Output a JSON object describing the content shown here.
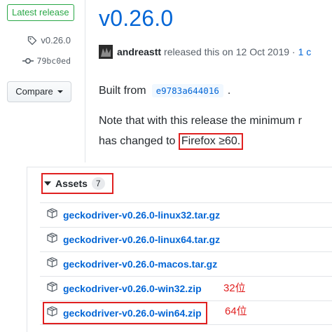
{
  "sidebar": {
    "badge": "Latest release",
    "tag": "v0.26.0",
    "commit": "79bc0ed",
    "compare_label": "Compare"
  },
  "release": {
    "title": "v0.26.0",
    "author": "andreastt",
    "released_text": "released this on 12 Oct 2019 ·",
    "commits_link": "1 c",
    "built_prefix": "Built from",
    "built_sha": "e9783a644016",
    "built_suffix": ".",
    "note_line1": "Note that with this release the minimum r",
    "note_line2_prefix": "has changed to",
    "note_highlight": "Firefox ≥60."
  },
  "assets": {
    "label": "Assets",
    "count": "7",
    "items": [
      {
        "name": "geckodriver-v0.26.0-linux32.tar.gz"
      },
      {
        "name": "geckodriver-v0.26.0-linux64.tar.gz"
      },
      {
        "name": "geckodriver-v0.26.0-macos.tar.gz"
      },
      {
        "name": "geckodriver-v0.26.0-win32.zip",
        "note": "32位"
      },
      {
        "name": "geckodriver-v0.26.0-win64.zip",
        "note": "64位"
      }
    ]
  },
  "colors": {
    "link": "#0366d6",
    "badge_green": "#28a745",
    "annotation_red": "#e02020"
  }
}
